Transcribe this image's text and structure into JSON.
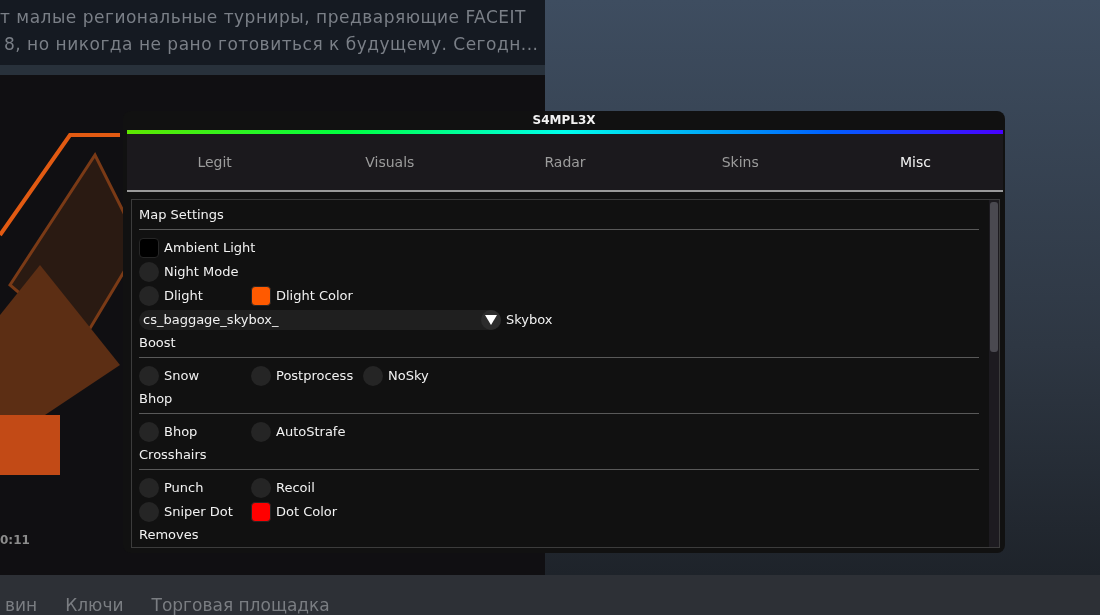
{
  "background_page": {
    "article_snippet": [
      "т малые региональные турниры, предваряющие FACEIT",
      "8, но никогда не рано готовиться к будущему. Сегодн..."
    ],
    "video_time": "0:11",
    "nav_items": [
      "вин",
      "Ключи",
      "Торговая площадка"
    ]
  },
  "menu": {
    "title": "S4MPL3X",
    "tabs": [
      {
        "label": "Legit",
        "selected": false
      },
      {
        "label": "Visuals",
        "selected": false
      },
      {
        "label": "Radar",
        "selected": false
      },
      {
        "label": "Skins",
        "selected": false
      },
      {
        "label": "Misc",
        "selected": true
      }
    ],
    "sections": [
      {
        "title": "Map Settings",
        "rows": [
          [
            {
              "kind": "color",
              "label": "Ambient Light",
              "color": "#000000"
            }
          ],
          [
            {
              "kind": "checkbox",
              "label": "Night Mode",
              "checked": false
            }
          ],
          [
            {
              "kind": "checkbox",
              "label": "Dlight",
              "checked": false
            },
            {
              "kind": "color",
              "label": "Dlight Color",
              "color": "#ff5a00"
            }
          ],
          [
            {
              "kind": "combo",
              "value": "cs_baggage_skybox_",
              "label": "Skybox"
            }
          ]
        ]
      },
      {
        "title": "Boost",
        "rows": [
          [
            {
              "kind": "checkbox",
              "label": "Snow",
              "checked": false
            },
            {
              "kind": "checkbox",
              "label": "Postprocess",
              "checked": false
            },
            {
              "kind": "checkbox",
              "label": "NoSky",
              "checked": false
            }
          ]
        ]
      },
      {
        "title": "Bhop",
        "rows": [
          [
            {
              "kind": "checkbox",
              "label": "Bhop",
              "checked": false
            },
            {
              "kind": "checkbox",
              "label": "AutoStrafe",
              "checked": false
            }
          ]
        ]
      },
      {
        "title": "Crosshairs",
        "rows": [
          [
            {
              "kind": "checkbox",
              "label": "Punch",
              "checked": false
            },
            {
              "kind": "checkbox",
              "label": "Recoil",
              "checked": false
            }
          ],
          [
            {
              "kind": "checkbox",
              "label": "Sniper Dot",
              "checked": false
            },
            {
              "kind": "color",
              "label": "Dot Color",
              "color": "#ff0000"
            }
          ]
        ]
      },
      {
        "title": "Removes"
      }
    ]
  }
}
